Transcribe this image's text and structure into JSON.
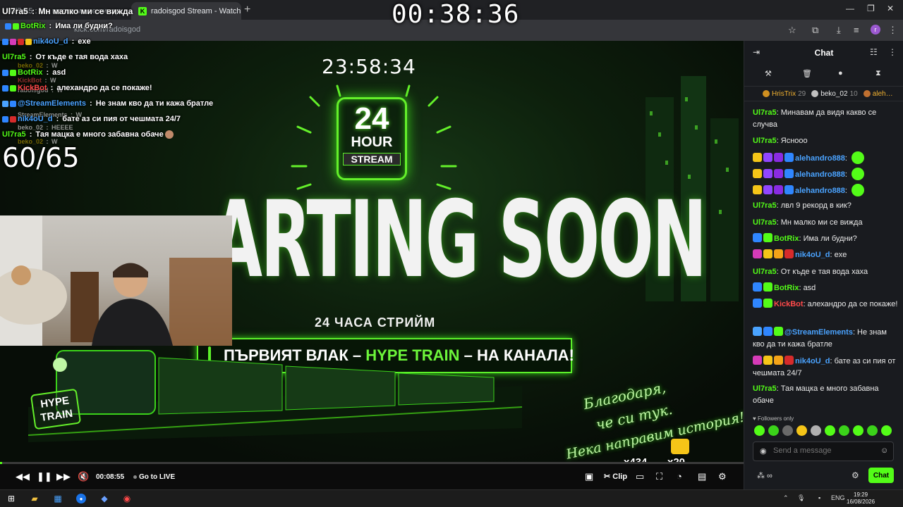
{
  "browser": {
    "tabs": [
      {
        "label": "Ul7ra5 : Мн малко ми се вижда",
        "active": false
      },
      {
        "label": "radoisgod Stream - Watch Live",
        "active": true,
        "favicon": "K"
      }
    ],
    "url": "kick.com/radoisgod"
  },
  "overlay_timer": "00:38:36",
  "stream_scene": {
    "countdown": "23:58:34",
    "badge": {
      "number": "24",
      "word": "HOUR",
      "label": "STREAM"
    },
    "headline": "ARTING SOON",
    "subtitle": "24 ЧАСА СТРИЙМ",
    "banner": {
      "before": "ПЪРВИЯТ ВЛАК – ",
      "highlight": "HYPE TRAIN",
      "after": " – НА КАНАЛА!"
    },
    "hype_sign": {
      "line1": "HYPE",
      "line2": "TRAIN"
    },
    "script_lines": [
      "Благодаря,",
      "че си тук.",
      "Нека направим история!"
    ],
    "gift_counts": [
      "x434",
      "x20"
    ],
    "viewer_ratio": "60/65",
    "colors": {
      "accent": "#53fc18",
      "glow": "#64f02a"
    }
  },
  "overlay_chat": [
    {
      "user": "Ul7ra5",
      "text": "Мн малко ми се вижда",
      "color": "#ffffff"
    },
    {
      "user": "BotRix",
      "text": "Има ли будни?",
      "color": "#53fc18"
    },
    {
      "user": "nik4oU_d",
      "text": "exe",
      "color": "#4aa3ff"
    },
    {
      "user": "Ul7ra5",
      "text": "От къде е тая вода хаха",
      "color": "#ffffff"
    },
    {
      "user": "BotRix",
      "text": "asd",
      "color": "#53fc18"
    },
    {
      "user": "KickBot",
      "text": "алехандро да се покаже!",
      "color": "#ff4a4a"
    },
    {
      "user": "@StreamElements",
      "text": "Не знам кво да ти кажа братле",
      "color": "#4aa3ff"
    },
    {
      "user": "nik4oU_d",
      "text": "бате аз си пия от чешмата 24/7",
      "color": "#4aa3ff"
    },
    {
      "user": "Ul7ra5",
      "text": "Тая мацка е много забавна обаче",
      "color": "#ffffff"
    }
  ],
  "overlay_chat_faint": [
    {
      "user": "beko_02",
      "text": "W"
    },
    {
      "user": "KickBot",
      "text": "W"
    },
    {
      "user": "radoisgod",
      "text": "W"
    },
    {
      "user": "StreamElements",
      "text": "W"
    },
    {
      "user": "beko_02",
      "text": "HEEEE"
    },
    {
      "user": "beko_02",
      "text": "W"
    }
  ],
  "player": {
    "elapsed": "00:08:55",
    "go_live": "Go to LIVE",
    "clip_label": "Clip",
    "progress_fraction": 0.003
  },
  "chat": {
    "title": "Chat",
    "leaderboard": [
      {
        "name": "HrisTrix",
        "count": "29",
        "color": "#f0b030",
        "coin": "#d09020"
      },
      {
        "name": "beko_02",
        "count": "10",
        "color": "#e8e8e8",
        "coin": "#c0c0c0"
      },
      {
        "name": "aleh…",
        "count": "",
        "color": "#f0b030",
        "coin": "#c07030"
      }
    ],
    "messages": [
      {
        "user": "Ul7ra5",
        "text": "Минавам да видя какво се случва",
        "color": "#53fc18",
        "badges": []
      },
      {
        "user": "Ul7ra5",
        "text": "Ясноoo",
        "color": "#53fc18",
        "badges": []
      },
      {
        "user": "alehandro888",
        "text": "",
        "color": "#4aa3ff",
        "badges": [
          "#f5c518",
          "#9146ff",
          "#8a2be2",
          "#2f86ff"
        ]
      },
      {
        "user": "alehandro888",
        "text": "",
        "color": "#4aa3ff",
        "badges": [
          "#f5c518",
          "#9146ff",
          "#8a2be2",
          "#2f86ff"
        ]
      },
      {
        "user": "alehandro888",
        "text": "",
        "color": "#4aa3ff",
        "badges": [
          "#f5c518",
          "#9146ff",
          "#8a2be2",
          "#2f86ff"
        ]
      },
      {
        "user": "Ul7ra5",
        "text": "лвл 9 рекорд в кик?",
        "color": "#53fc18",
        "badges": []
      },
      {
        "user": "Ul7ra5",
        "text": "Мн малко ми се вижда",
        "color": "#53fc18",
        "badges": []
      },
      {
        "user": "BotRix",
        "text": "Има ли будни?",
        "color": "#53fc18",
        "badges": [
          "#2f86ff",
          "#53fc18"
        ]
      },
      {
        "user": "nik4oU_d",
        "text": "exe",
        "color": "#4aa3ff",
        "badges": [
          "#d63bb8",
          "#f5c518",
          "#f5a418",
          "#d62b2b"
        ]
      },
      {
        "user": "Ul7ra5",
        "text": "От къде е тая вода хаха",
        "color": "#53fc18",
        "badges": []
      },
      {
        "user": "BotRix",
        "text": "asd",
        "color": "#53fc18",
        "badges": [
          "#2f86ff",
          "#53fc18"
        ]
      },
      {
        "user": "KickBot",
        "text": "алехандро да се покаже!",
        "color": "#ff4a4a",
        "badges": [
          "#2f86ff",
          "#53fc18"
        ]
      },
      {
        "user": "@StreamElements",
        "text": "Не знам кво да ти кажа братле",
        "color": "#4aa3ff",
        "badges": [
          "#4aa3ff",
          "#2f86ff",
          "#53fc18"
        ]
      },
      {
        "user": "nik4oU_d",
        "text": "бате аз си пия от чешмата 24/7",
        "color": "#4aa3ff",
        "badges": [
          "#d63bb8",
          "#f5c518",
          "#f5a418",
          "#d62b2b"
        ]
      },
      {
        "user": "Ul7ra5",
        "text": "Тая мацка е много забавна обаче",
        "color": "#53fc18",
        "badges": []
      }
    ],
    "followers_only": "Followers only",
    "input_placeholder": "Send a message",
    "send_label": "Chat"
  },
  "taskbar": {
    "language": "ENG",
    "time": "19:29",
    "date": "16/08/2026"
  }
}
